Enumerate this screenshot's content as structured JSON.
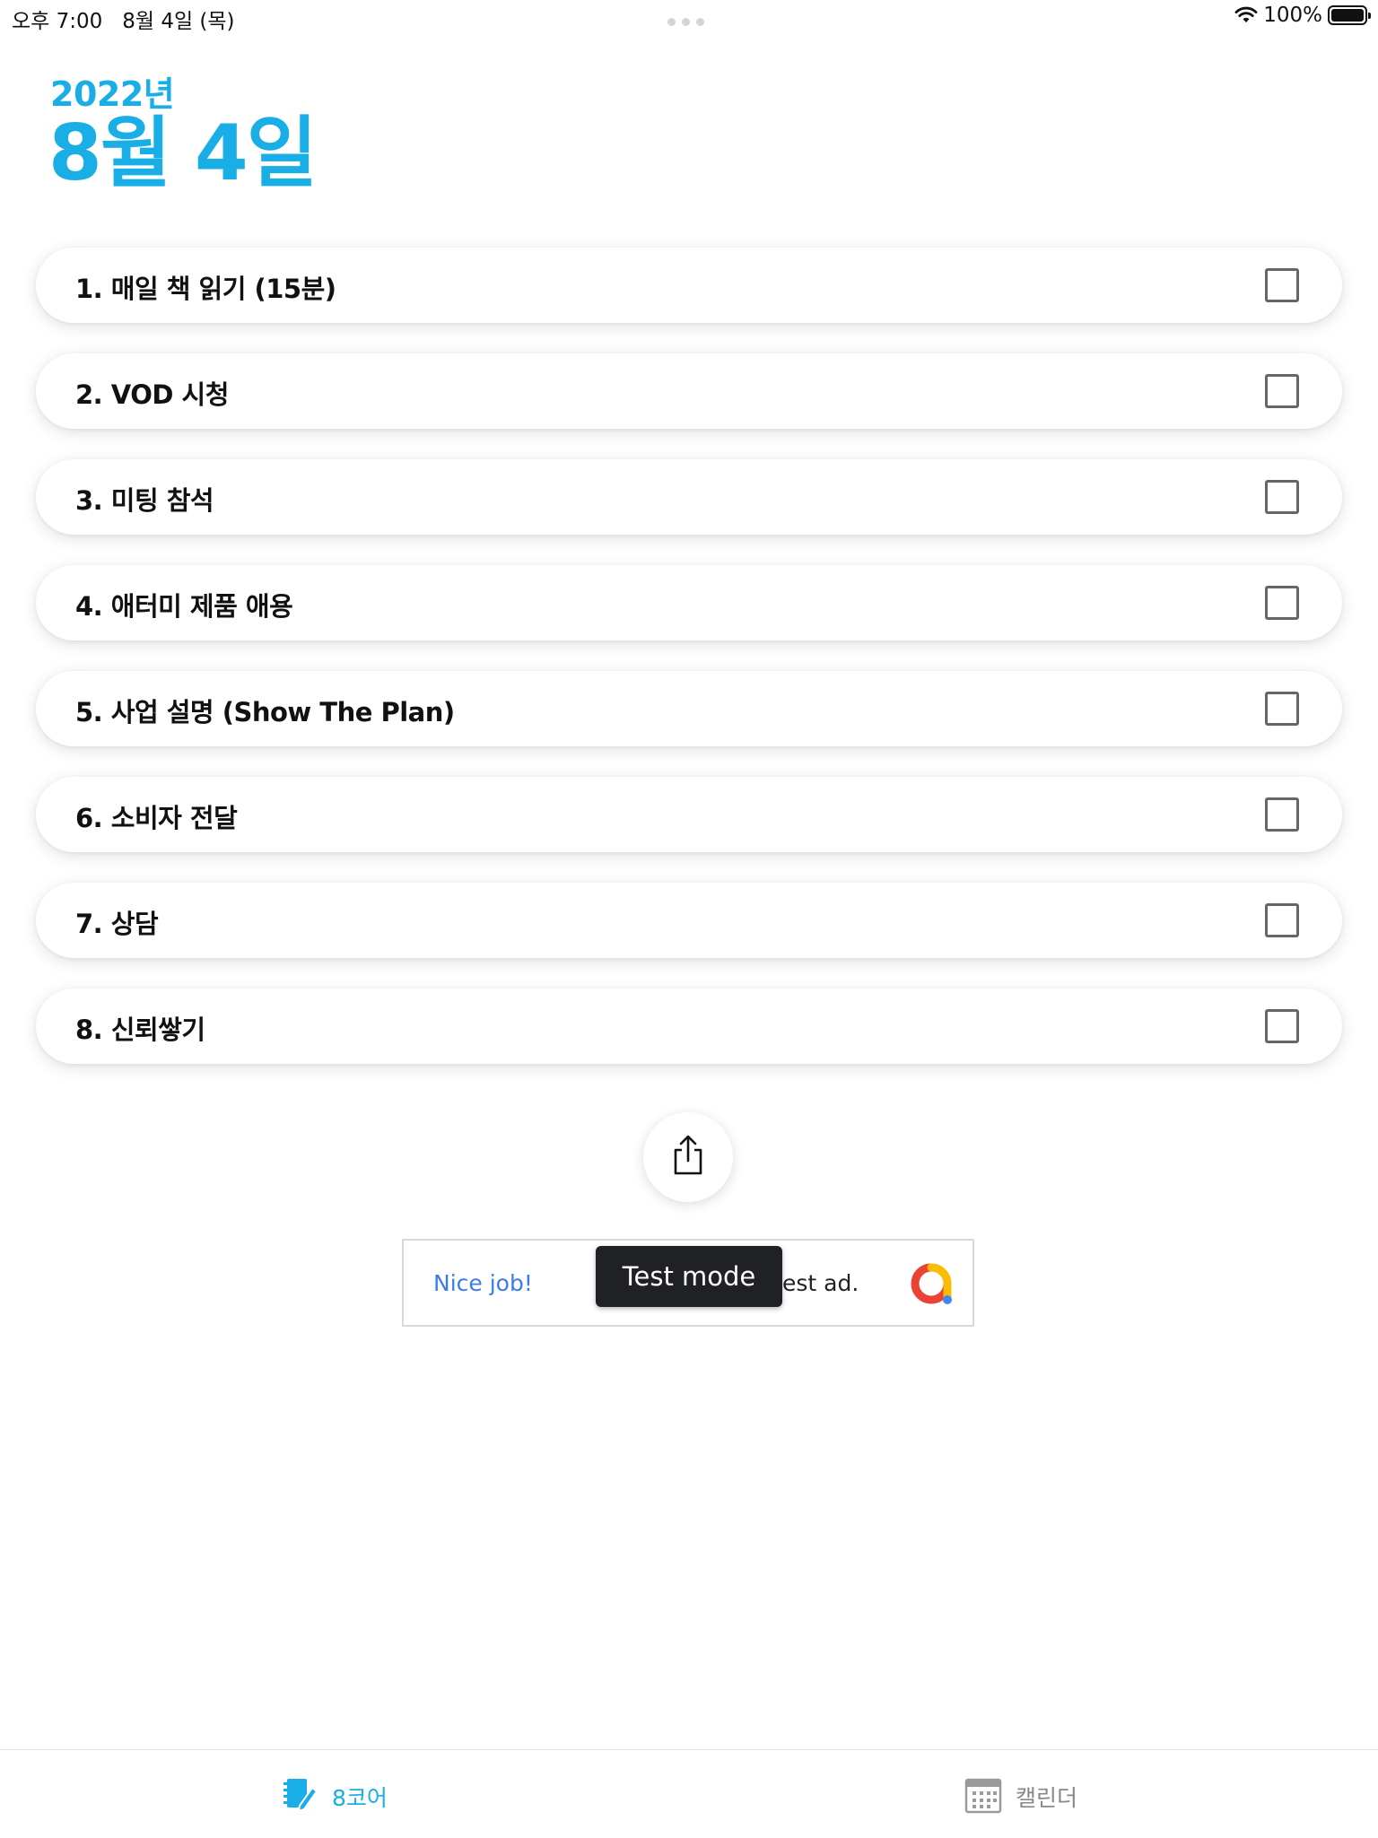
{
  "status_bar": {
    "time": "오후 7:00",
    "date": "8월 4일 (목)",
    "battery": "100%"
  },
  "header": {
    "year": "2022년",
    "date": "8월 4일"
  },
  "tasks": [
    {
      "label": "1. 매일 책 읽기 (15분)",
      "checked": false
    },
    {
      "label": "2. VOD 시청",
      "checked": false
    },
    {
      "label": "3. 미팅 참석",
      "checked": false
    },
    {
      "label": "4. 애터미 제품 애용",
      "checked": false
    },
    {
      "label": "5. 사업 설명 (Show The Plan)",
      "checked": false
    },
    {
      "label": "6. 소비자 전달",
      "checked": false
    },
    {
      "label": "7. 상담",
      "checked": false
    },
    {
      "label": "8. 신뢰쌓기",
      "checked": false
    }
  ],
  "share_icon": "share-icon",
  "ad": {
    "nice": "Nice job!",
    "text": "est ad.",
    "toast": "Test mode"
  },
  "tabbar": {
    "tabs": [
      {
        "label": "8코어",
        "icon": "notebook-pen-icon",
        "active": true
      },
      {
        "label": "캘린더",
        "icon": "calendar-icon",
        "active": false
      }
    ]
  },
  "colors": {
    "accent": "#1aaee6",
    "ad_link": "#3b7de4",
    "toast_bg": "#202124"
  }
}
